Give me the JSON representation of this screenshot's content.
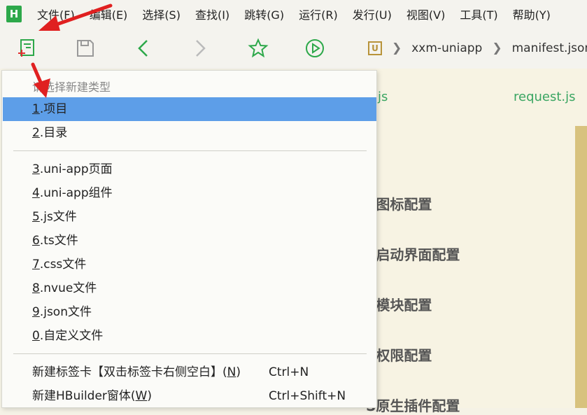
{
  "menubar": {
    "logo_letter": "H",
    "items": [
      {
        "label": "文件(F)"
      },
      {
        "label": "编辑(E)"
      },
      {
        "label": "选择(S)"
      },
      {
        "label": "查找(I)"
      },
      {
        "label": "跳转(G)"
      },
      {
        "label": "运行(R)"
      },
      {
        "label": "发行(U)"
      },
      {
        "label": "视图(V)"
      },
      {
        "label": "工具(T)"
      },
      {
        "label": "帮助(Y)"
      }
    ]
  },
  "toolbar": {
    "new_icon": "new-file-icon",
    "save_icon": "save-icon",
    "back_icon": "chevron-left-icon",
    "forward_icon": "chevron-right-icon",
    "favorite_icon": "star-icon",
    "run_icon": "play-circle-icon"
  },
  "breadcrumb": {
    "project_icon_letter": "U",
    "items": [
      "xxm-uniapp",
      "manifest.json"
    ]
  },
  "editor": {
    "tabs": [
      "js",
      "request.js"
    ],
    "sections": [
      "S图标配置",
      "S启动界面配置",
      "S模块配置",
      "S权限配置",
      "S原生插件配置"
    ]
  },
  "dropdown": {
    "header": "请选择新建类型",
    "items": [
      {
        "num": "1",
        "label": ".项目"
      },
      {
        "num": "2",
        "label": ".目录"
      },
      {
        "num": "3",
        "label": ".uni-app页面"
      },
      {
        "num": "4",
        "label": ".uni-app组件"
      },
      {
        "num": "5",
        "label": ".js文件"
      },
      {
        "num": "6",
        "label": ".ts文件"
      },
      {
        "num": "7",
        "label": ".css文件"
      },
      {
        "num": "8",
        "label": ".nvue文件"
      },
      {
        "num": "9",
        "label": ".json文件"
      },
      {
        "num": "0",
        "label": ".自定义文件"
      }
    ],
    "extra": [
      {
        "pre": "新建标签卡【双击标签卡右侧空白】(",
        "key": "N",
        "post": ")",
        "shortcut": "Ctrl+N"
      },
      {
        "pre": "新建HBuilder窗体(",
        "key": "W",
        "post": ")",
        "shortcut": "Ctrl+Shift+N"
      }
    ]
  },
  "colors": {
    "accent": "#2da84a",
    "highlight": "#5d9ee8",
    "arrow": "#e02020"
  }
}
